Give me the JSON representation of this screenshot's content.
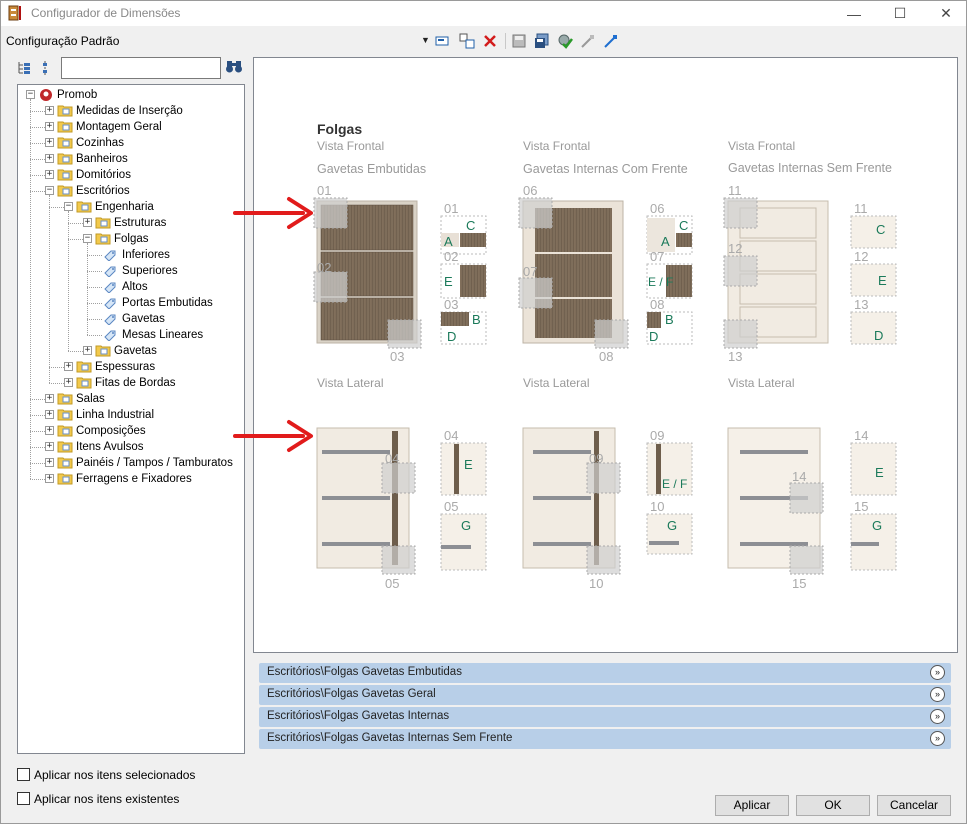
{
  "window": {
    "title": "Configurador de Dimensões",
    "min": "—",
    "max": "☐",
    "close": "✕"
  },
  "toolbar": {
    "config_label": "Configuração Padrão",
    "dropdown_arrow": "▼"
  },
  "tree": {
    "items": [
      {
        "label": "Promob"
      },
      {
        "label": "Medidas de Inserção"
      },
      {
        "label": "Montagem Geral"
      },
      {
        "label": "Cozinhas"
      },
      {
        "label": "Banheiros"
      },
      {
        "label": "Domitórios"
      },
      {
        "label": "Escritórios"
      },
      {
        "label": "Engenharia"
      },
      {
        "label": "Estruturas"
      },
      {
        "label": "Folgas"
      },
      {
        "label": "Inferiores"
      },
      {
        "label": "Superiores"
      },
      {
        "label": "Altos"
      },
      {
        "label": "Portas Embutidas"
      },
      {
        "label": "Gavetas"
      },
      {
        "label": "Mesas Lineares"
      },
      {
        "label": "Gavetas"
      },
      {
        "label": "Espessuras"
      },
      {
        "label": "Fitas de Bordas"
      },
      {
        "label": "Salas"
      },
      {
        "label": "Linha Industrial"
      },
      {
        "label": "Composições"
      },
      {
        "label": "Itens Avulsos"
      },
      {
        "label": "Painéis / Tampos / Tamburatos"
      },
      {
        "label": "Ferragens e Fixadores"
      }
    ]
  },
  "diagram": {
    "title": "Folgas",
    "sections": [
      {
        "view": "Vista Frontal",
        "subtitle": "Gavetas Embutidas"
      },
      {
        "view": "Vista Frontal",
        "subtitle": "Gavetas Internas Com Frente"
      },
      {
        "view": "Vista Frontal",
        "subtitle": "Gavetas Internas Sem Frente"
      }
    ],
    "lateral": [
      "Vista Lateral",
      "Vista Lateral",
      "Vista Lateral"
    ],
    "numbers": [
      "01",
      "02",
      "03",
      "04",
      "05",
      "06",
      "07",
      "08",
      "09",
      "10",
      "11",
      "12",
      "13",
      "14",
      "15"
    ],
    "letters": {
      "a": "A",
      "b": "B",
      "c": "C",
      "d": "D",
      "e": "E",
      "ef": "E / F",
      "g": "G"
    }
  },
  "accordion": [
    {
      "label": "Escritórios\\Folgas Gavetas Embutidas"
    },
    {
      "label": "Escritórios\\Folgas Gavetas Geral"
    },
    {
      "label": "Escritórios\\Folgas Gavetas Internas"
    },
    {
      "label": "Escritórios\\Folgas Gavetas Internas Sem Frente"
    }
  ],
  "accordion_icon": "»",
  "options": {
    "apply_selected": "Aplicar nos itens selecionados",
    "apply_existing": "Aplicar nos itens existentes"
  },
  "buttons": {
    "apply": "Aplicar",
    "ok": "OK",
    "cancel": "Cancelar"
  },
  "colors": {
    "accent": "#b8cfe8",
    "arrow": "#e11b1b",
    "wood": "#7b6a58",
    "label_green": "#1b7a5a"
  }
}
